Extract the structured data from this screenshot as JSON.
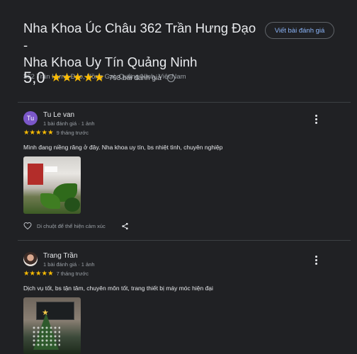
{
  "header": {
    "title_line1": "Nha Khoa Úc Châu 362 Trần Hưng Đạo -",
    "title_line2": "Nha Khoa Uy Tín Quảng Ninh",
    "address": "362 Trần Hưng Đạo, Hồng Gai, Quảng Ninh, Việt Nam",
    "write_review": "Viết bài đánh giá"
  },
  "summary": {
    "rating": "5,0",
    "stars": "★★★★★",
    "count": "798 bài đánh giá",
    "info_glyph": "i"
  },
  "reviews": [
    {
      "avatar_initials": "Tu",
      "name": "Tu Le van",
      "meta": "1 bài đánh giá · 1 ảnh",
      "stars": "★★★★★",
      "time": "9 tháng trước",
      "text": "Mình đang niềng răng ở đây. Nha khoa uy tín, bs nhiệt tình, chuyên nghiệp",
      "react_label": "Di chuột để thể hiện cảm xúc"
    },
    {
      "name": "Trang Trần",
      "meta": "1 bài đánh giá · 1 ảnh",
      "stars": "★★★★★",
      "time": "7 tháng trước",
      "text": "Dịch vụ tốt, bs tận tâm, chuyên môn tốt, trang thiết bị máy móc hiện đại"
    }
  ],
  "icons": {
    "more": "more-vert-icon",
    "heart": "heart-outline-icon",
    "share": "share-icon",
    "info": "info-icon"
  },
  "colors": {
    "background": "#202124",
    "star": "#fbbc04",
    "accent": "#8ab4f8",
    "avatar_tu": "#7b57c9"
  }
}
